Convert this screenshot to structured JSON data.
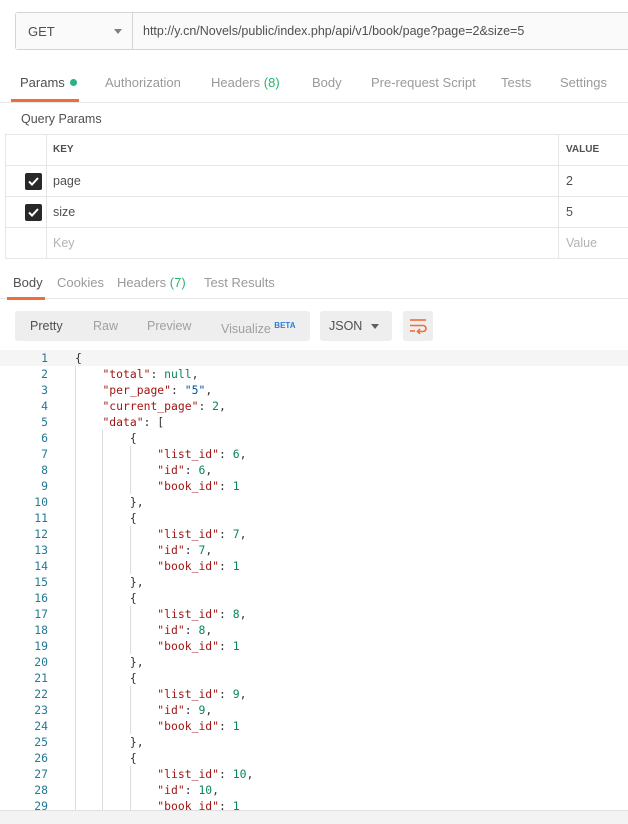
{
  "request": {
    "method": "GET",
    "url": "http://y.cn/Novels/public/index.php/api/v1/book/page?page=2&size=5"
  },
  "request_tabs": {
    "params": "Params",
    "authorization": "Authorization",
    "headers": "Headers",
    "headers_count": "(8)",
    "body": "Body",
    "prerequest": "Pre-request Script",
    "tests": "Tests",
    "settings": "Settings"
  },
  "query_params": {
    "title": "Query Params",
    "key_header": "KEY",
    "value_header": "VALUE",
    "rows": [
      {
        "key": "page",
        "value": "2",
        "checked": true
      },
      {
        "key": "size",
        "value": "5",
        "checked": true
      }
    ],
    "key_placeholder": "Key",
    "value_placeholder": "Value"
  },
  "response_tabs": {
    "body": "Body",
    "cookies": "Cookies",
    "headers": "Headers",
    "headers_count": "(7)",
    "test_results": "Test Results"
  },
  "toolbar": {
    "pretty": "Pretty",
    "raw": "Raw",
    "preview": "Preview",
    "visualize": "Visualize",
    "beta": "BETA",
    "format": "JSON",
    "wrap_icon": "wrap-lines-icon"
  },
  "code_lines": [
    "{",
    "    \"total\": null,",
    "    \"per_page\": \"5\",",
    "    \"current_page\": 2,",
    "    \"data\": [",
    "        {",
    "            \"list_id\": 6,",
    "            \"id\": 6,",
    "            \"book_id\": 1",
    "        },",
    "        {",
    "            \"list_id\": 7,",
    "            \"id\": 7,",
    "            \"book_id\": 1",
    "        },",
    "        {",
    "            \"list_id\": 8,",
    "            \"id\": 8,",
    "            \"book_id\": 1",
    "        },",
    "        {",
    "            \"list_id\": 9,",
    "            \"id\": 9,",
    "            \"book_id\": 1",
    "        },",
    "        {",
    "            \"list_id\": 10,",
    "            \"id\": 10,",
    "            \"book_id\": 1"
  ],
  "colors": {
    "accent": "#f26b3a",
    "count_green": "#2bb36e",
    "json_key": "#a31515",
    "json_number": "#098658",
    "json_string": "#0451a5"
  }
}
